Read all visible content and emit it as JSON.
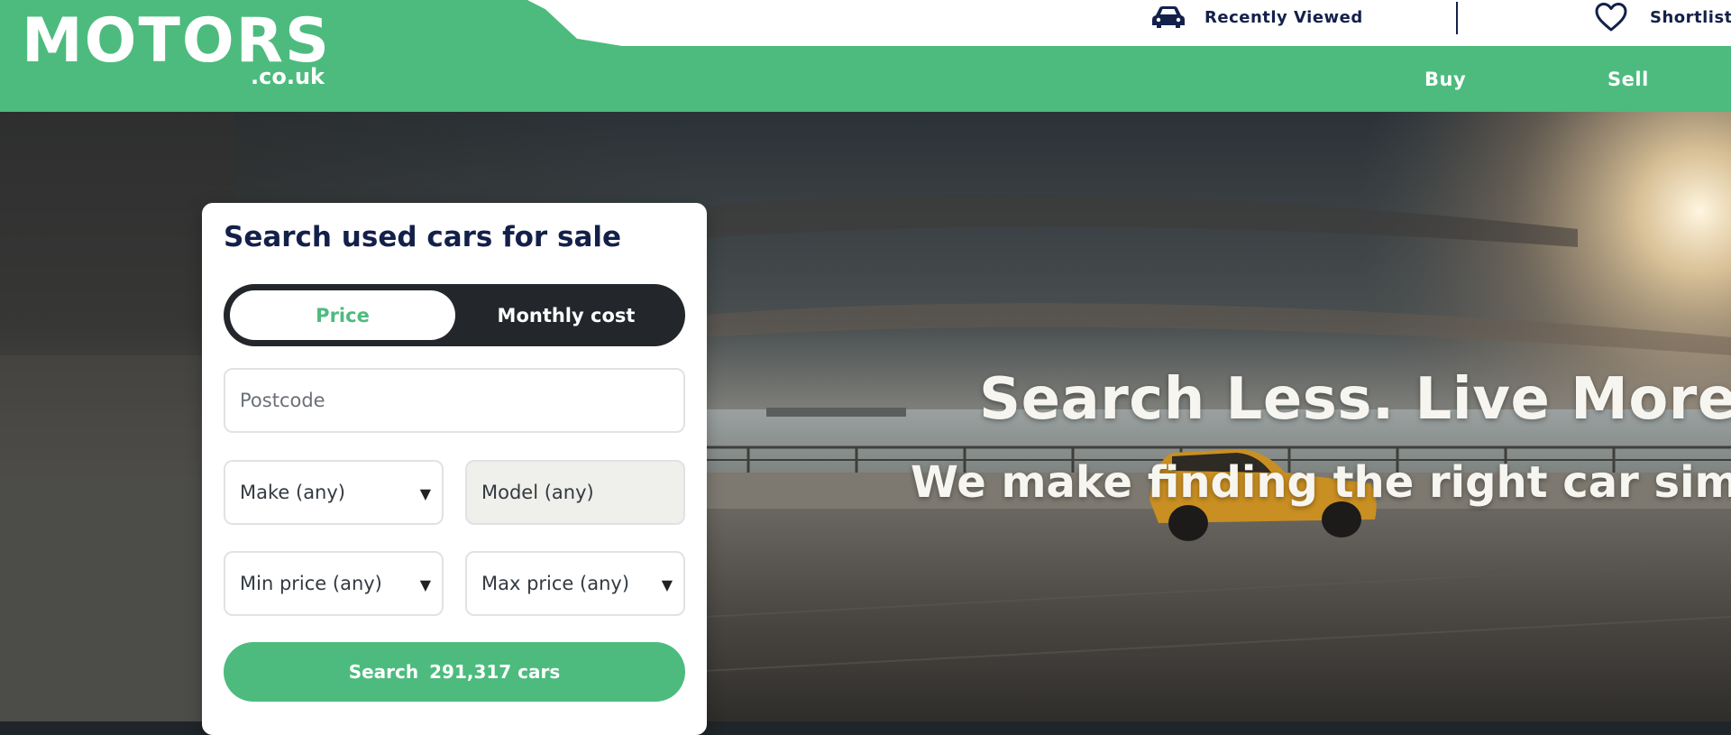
{
  "brand": {
    "logo_main": "MOTORS",
    "logo_sub": ".co.uk",
    "accent": "#4dbb7e",
    "navy": "#13204a"
  },
  "header": {
    "recently_viewed": {
      "label": "Recently Viewed",
      "icon": "car-icon"
    },
    "shortlist": {
      "label": "Shortlist",
      "icon": "heart-icon"
    },
    "nav": {
      "buy": "Buy",
      "sell": "Sell"
    }
  },
  "hero": {
    "title": "Search Less. Live More.",
    "subtitle": "We make finding the right car simple"
  },
  "search": {
    "title": "Search used cars for sale",
    "toggle": {
      "price": "Price",
      "monthly": "Monthly cost",
      "selected": "Price"
    },
    "postcode_placeholder": "Postcode",
    "make": "Make (any)",
    "model": "Model (any)",
    "min_price": "Min price (any)",
    "max_price": "Max price (any)",
    "button_label": "Search",
    "button_count": "291,317 cars",
    "caret": "▼"
  }
}
